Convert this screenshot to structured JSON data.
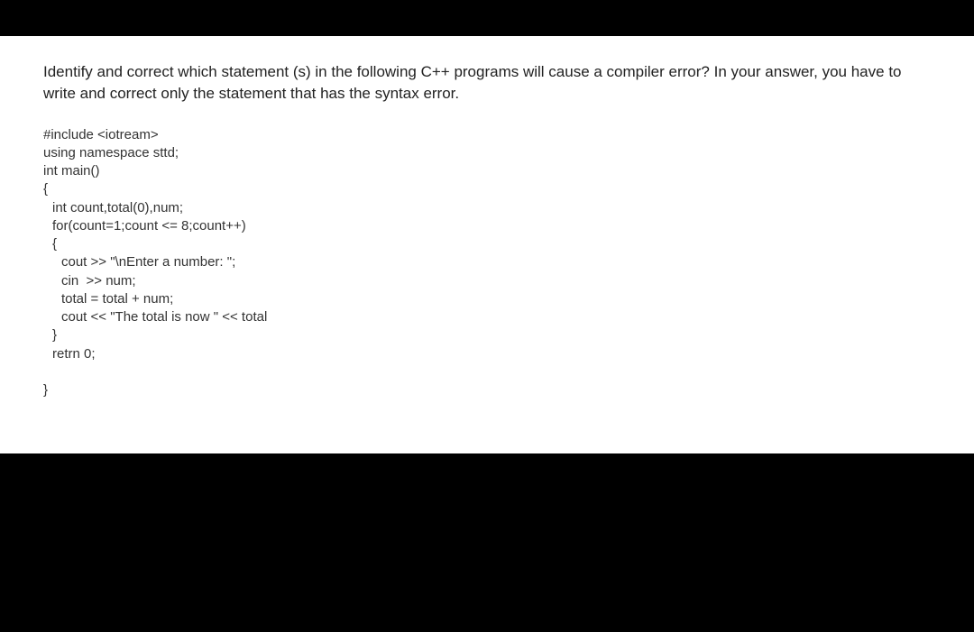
{
  "question": "Identify and correct which statement (s) in the following C++ programs will cause a compiler error? In your answer, you have to write and correct only the statement that has the syntax error.",
  "code": {
    "line1": "#include <iotream>",
    "line2": "using namespace sttd;",
    "line3": "int main()",
    "line4": "{",
    "line5": "int count,total(0),num;",
    "line6": "for(count=1;count <= 8;count++)",
    "line7": "{",
    "line8": "cout >> \"\\nEnter a number: \";",
    "line9": "cin  >> num;",
    "line10": "total = total + num;",
    "line11": "cout << \"The total is now \" << total",
    "line12": "}",
    "line13": "retrn 0;",
    "line14": "}"
  }
}
